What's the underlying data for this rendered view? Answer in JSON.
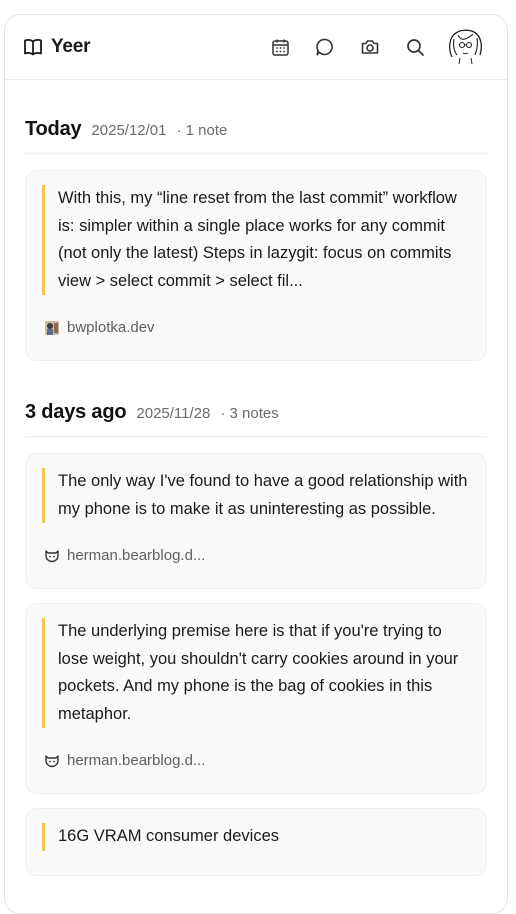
{
  "app": {
    "name": "Yeer"
  },
  "header": {
    "icons": [
      "calendar-icon",
      "chat-icon",
      "camera-icon",
      "search-icon",
      "avatar"
    ]
  },
  "sections": [
    {
      "title": "Today",
      "date": "2025/12/01",
      "count": "· 1 note",
      "notes": [
        {
          "text": "With this, my “line reset from the last commit” workflow is: simpler within a single place works for any commit (not only the latest) Steps in lazygit: focus on commits view > select commit > select fil...",
          "source": "bwplotka.dev"
        }
      ]
    },
    {
      "title": "3 days ago",
      "date": "2025/11/28",
      "count": "· 3 notes",
      "notes": [
        {
          "text": "The only way I've found to have a good relationship with my phone is to make it as uninteresting as possible.",
          "source": "herman.bearblog.d..."
        },
        {
          "text": "The underlying premise here is that if you're trying to lose weight, you shouldn't carry cookies around in your pockets. And my phone is the bag of cookies in this metaphor.",
          "source": "herman.bearblog.d..."
        },
        {
          "text": "16G VRAM consumer devices",
          "source": ""
        }
      ]
    }
  ],
  "colors": {
    "accent": "#f1c453",
    "muted": "#6b6b6b"
  }
}
